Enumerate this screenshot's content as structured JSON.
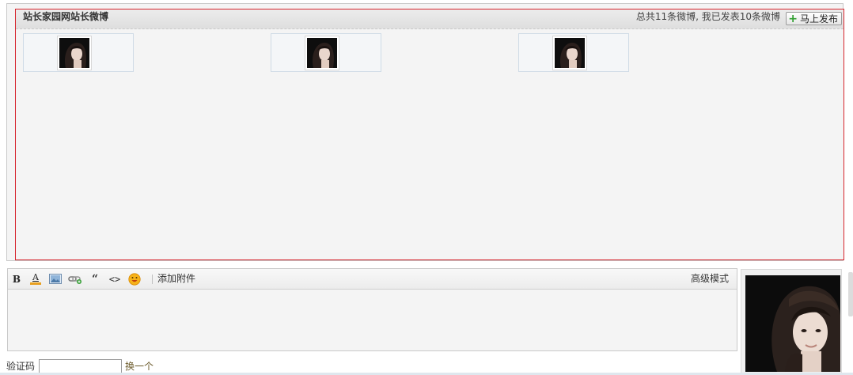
{
  "feed": {
    "title": "站长家园网站长微博",
    "count_text": "总共11条微博, 我已发表10条微博",
    "publish_label": "马上发布",
    "posts": [
      {
        "avatar": "user-avatar"
      },
      {
        "avatar": "user-avatar"
      },
      {
        "avatar": "user-avatar"
      }
    ]
  },
  "editor": {
    "toolbar": {
      "bold_label": "B",
      "font_color_label": "A",
      "tools": [
        "bold-icon",
        "font-color-icon",
        "image-icon",
        "link-icon",
        "quote-icon",
        "code-icon",
        "emoji-icon"
      ],
      "attach_label": "添加附件",
      "advanced_label": "高级模式"
    },
    "content": ""
  },
  "captcha": {
    "label": "验证码",
    "value": "",
    "swap_label": "换一个"
  },
  "colors": {
    "feed_border": "#d6252d",
    "publish_plus": "#2e9e2e",
    "swap_link": "#6b5a2a"
  }
}
